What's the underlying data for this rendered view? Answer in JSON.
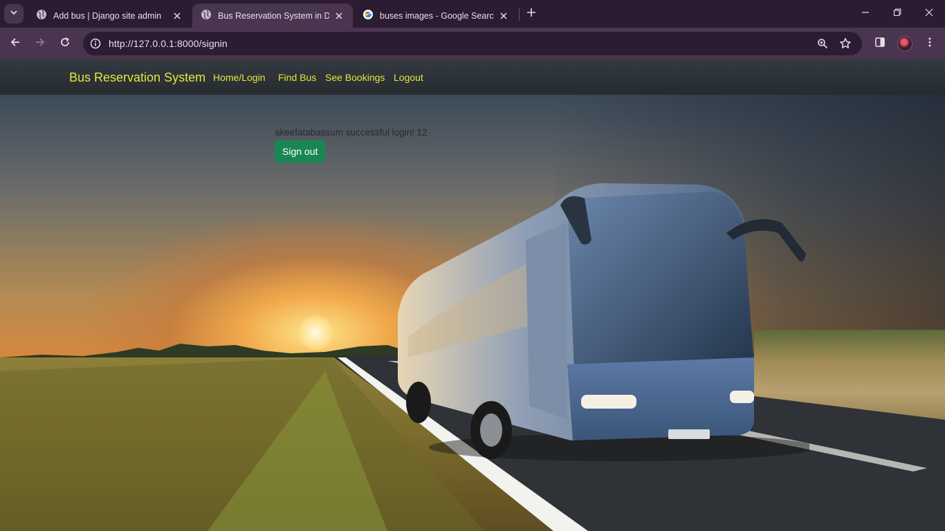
{
  "browser": {
    "tabs": [
      {
        "title": "Add bus | Django site admin",
        "active": false
      },
      {
        "title": "Bus Reservation System in Djan",
        "active": true
      },
      {
        "title": "buses images - Google Search",
        "active": false
      }
    ],
    "url": "http://127.0.0.1:8000/signin",
    "icons": [
      "tab-search-icon",
      "globe-icon",
      "close-icon",
      "google-icon",
      "plus-icon",
      "minimize-icon",
      "restore-icon",
      "window-close-icon",
      "back-arrow-icon",
      "forward-arrow-icon",
      "reload-icon",
      "info-icon",
      "zoom-icon",
      "star-icon",
      "side-panel-icon",
      "kebab-menu-icon"
    ]
  },
  "navbar": {
    "brand": "Bus Reservation System",
    "links": [
      "Home/Login",
      "Find Bus",
      "See Bookings",
      "Logout"
    ]
  },
  "main": {
    "message": "akeefatabassum successful login! 12",
    "signout_label": "Sign out"
  },
  "colors": {
    "chrome_dark": "#2c1c32",
    "chrome_toolbar": "#4a3550",
    "navbar_bg": "#2d3338",
    "brand_yellow": "#e5e83a",
    "button_green": "#198754"
  }
}
